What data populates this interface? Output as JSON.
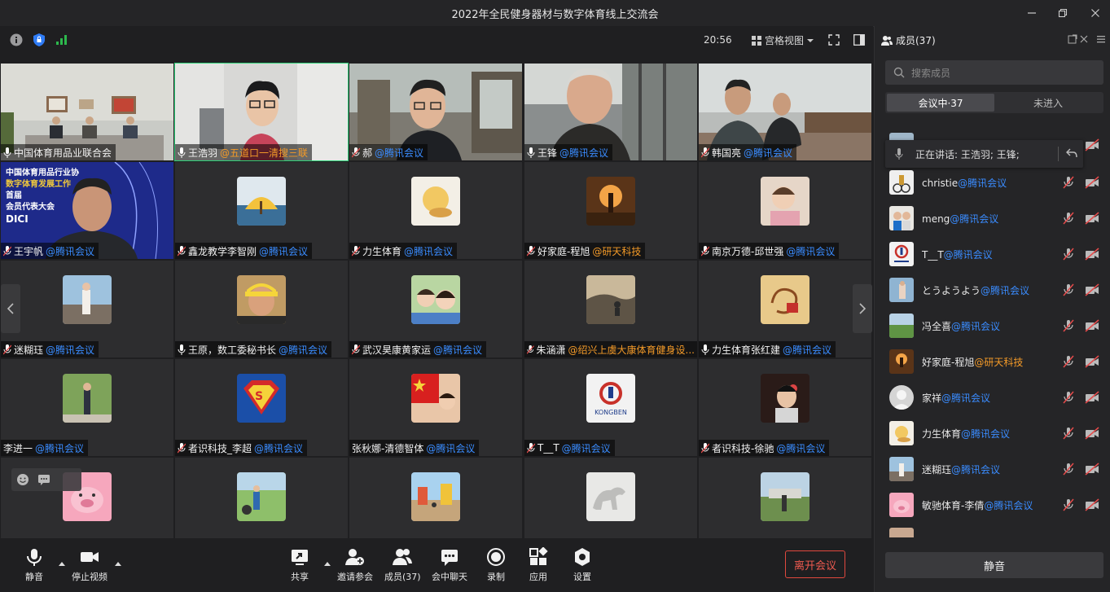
{
  "window": {
    "title": "2022年全民健身器材与数字体育线上交流会"
  },
  "topbar": {
    "time": "20:56",
    "view_mode": "宫格视图"
  },
  "tiles": [
    {
      "name": "中国体育用品业联合会",
      "host": ""
    },
    {
      "name": "王浩羽",
      "host": "@五道口一清搜三联",
      "host_orange": true
    },
    {
      "name": "郝",
      "host": "@腾讯会议"
    },
    {
      "name": "王锋",
      "host": "@腾讯会议"
    },
    {
      "name": "韩国亮",
      "host": "@腾讯会议"
    },
    {
      "name": "王宇帆",
      "host": "@腾讯会议"
    },
    {
      "name": "鑫龙教学李智刚",
      "host": "@腾讯会议"
    },
    {
      "name": "力生体育",
      "host": "@腾讯会议"
    },
    {
      "name": "好家庭-程旭",
      "host": "@研天科技",
      "host_orange": true
    },
    {
      "name": "南京万德-邱世强",
      "host": "@腾讯会议"
    },
    {
      "name": "迷糊珏",
      "host": "@腾讯会议"
    },
    {
      "name": "王原，数工委秘书长",
      "host": "@腾讯会议"
    },
    {
      "name": "武汉昊康黄家运",
      "host": "@腾讯会议"
    },
    {
      "name": "朱涵潇",
      "host": "@绍兴上虞大康体育健身设...",
      "host_orange": true
    },
    {
      "name": "力生体育张红建",
      "host": "@腾讯会议"
    },
    {
      "name": "李进一",
      "host": "@腾讯会议"
    },
    {
      "name": "者识科技_李超",
      "host": "@腾讯会议"
    },
    {
      "name": "张秋娜-清德智体",
      "host": "@腾讯会议"
    },
    {
      "name": "T__T",
      "host": "@腾讯会议"
    },
    {
      "name": "者识科技-徐驰",
      "host": "@腾讯会议"
    },
    {
      "name": "",
      "host": ""
    },
    {
      "name": "",
      "host": ""
    },
    {
      "name": "",
      "host": ""
    },
    {
      "name": "",
      "host": ""
    },
    {
      "name": "",
      "host": ""
    }
  ],
  "video_overlay": {
    "banner_lines": [
      "中国体育用品行业协",
      "数字体育发展工作",
      "首届",
      "会员代表大会",
      "DICI"
    ]
  },
  "logo_text": "KONGBEN",
  "toolbar": {
    "mute": "静音",
    "stop_video": "停止视频",
    "share": "共享",
    "invite": "邀请参会",
    "members": "成员(37)",
    "chat": "会中聊天",
    "record": "录制",
    "apps": "应用",
    "settings": "设置",
    "leave": "离开会议"
  },
  "panel": {
    "title": "成员(37)",
    "search_placeholder": "搜索成员",
    "tab_in": "会议中·37",
    "tab_out": "未进入",
    "speaking": "正在讲话: 王浩羽; 王锋;",
    "members": [
      {
        "name": "christie",
        "host": "@腾讯会议"
      },
      {
        "name": "meng",
        "host": "@腾讯会议"
      },
      {
        "name": "T__T",
        "host": "@腾讯会议"
      },
      {
        "name": "とうようよう",
        "host": "@腾讯会议"
      },
      {
        "name": "冯全喜",
        "host": "@腾讯会议"
      },
      {
        "name": "好家庭-程旭",
        "host": "@研天科技",
        "host_orange": true
      },
      {
        "name": "家祥",
        "host": "@腾讯会议"
      },
      {
        "name": "力生体育",
        "host": "@腾讯会议"
      },
      {
        "name": "迷糊珏",
        "host": "@腾讯会议"
      },
      {
        "name": "敏驰体育-李倩",
        "host": "@腾讯会议"
      }
    ],
    "mute_all": "静音"
  },
  "colors": {
    "host_blue": "#3a8cff",
    "host_orange": "#f39a28",
    "leave_red": "#e0483e"
  }
}
